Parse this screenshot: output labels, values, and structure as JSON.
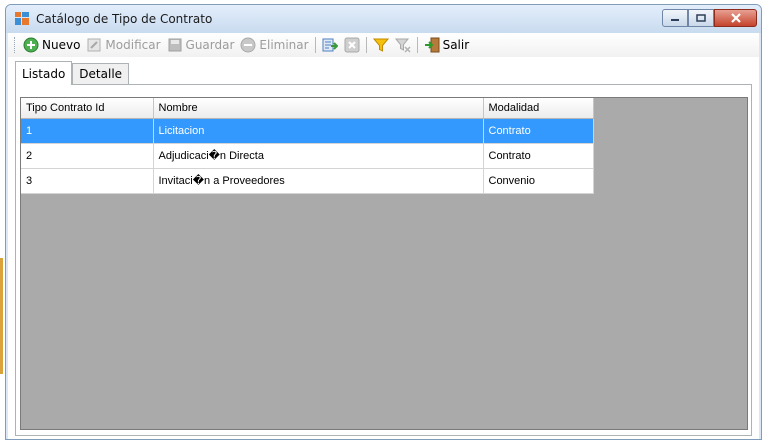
{
  "window": {
    "title": "Catálogo de Tipo de Contrato",
    "icon": "form-grid-icon"
  },
  "toolbar": {
    "items": [
      {
        "label": "Nuevo",
        "icon": "add-circle-icon",
        "enabled": true
      },
      {
        "label": "Modificar",
        "icon": "edit-icon",
        "enabled": false
      },
      {
        "label": "Guardar",
        "icon": "save-icon",
        "enabled": false
      },
      {
        "label": "Eliminar",
        "icon": "delete-circle-icon",
        "enabled": false
      },
      {
        "label": "",
        "icon": "export-icon",
        "enabled": true
      },
      {
        "label": "",
        "icon": "cancel-icon",
        "enabled": false
      },
      {
        "label": "",
        "icon": "filter-icon",
        "enabled": true
      },
      {
        "label": "",
        "icon": "clear-filter-icon",
        "enabled": false
      },
      {
        "label": "Salir",
        "icon": "exit-door-icon",
        "enabled": true
      }
    ]
  },
  "tabs": [
    {
      "label": "Listado",
      "active": true
    },
    {
      "label": "Detalle",
      "active": false
    }
  ],
  "grid": {
    "columns": [
      "Tipo Contrato Id",
      "Nombre",
      "Modalidad"
    ],
    "rows": [
      {
        "id": "1",
        "nombre": "Licitacion",
        "modalidad": "Contrato",
        "selected": true
      },
      {
        "id": "2",
        "nombre": "Adjudicaci�n Directa",
        "modalidad": "Contrato",
        "selected": false
      },
      {
        "id": "3",
        "nombre": "Invitaci�n a Proveedores",
        "modalidad": "Convenio",
        "selected": false
      }
    ]
  },
  "colors": {
    "selection": "#3399ff",
    "grid_background": "#aaaaaa",
    "title_bar": "#c9dbef"
  }
}
